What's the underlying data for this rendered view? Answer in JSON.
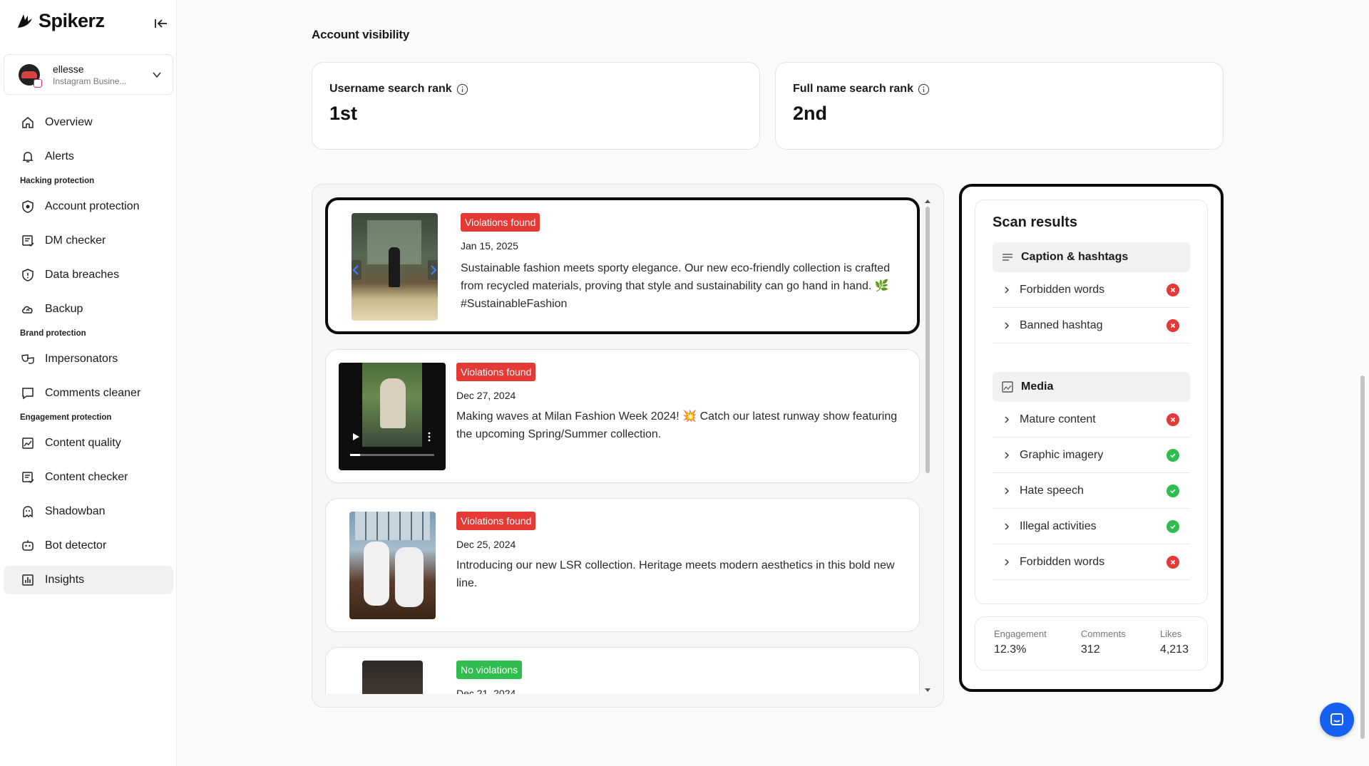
{
  "app": {
    "name": "Spikerz"
  },
  "account": {
    "name": "ellesse",
    "type": "Instagram Busine..."
  },
  "nav": {
    "overview": "Overview",
    "alerts": "Alerts",
    "section_hacking": "Hacking protection",
    "account_protection": "Account protection",
    "dm_checker": "DM checker",
    "data_breaches": "Data breaches",
    "backup": "Backup",
    "section_brand": "Brand protection",
    "impersonators": "Impersonators",
    "comments_cleaner": "Comments cleaner",
    "section_engagement": "Engagement protection",
    "content_quality": "Content quality",
    "content_checker": "Content checker",
    "shadowban": "Shadowban",
    "bot_detector": "Bot detector",
    "insights": "Insights"
  },
  "visibility": {
    "title": "Account visibility",
    "username_label": "Username search rank",
    "username_value": "1st",
    "fullname_label": "Full name search rank",
    "fullname_value": "2nd"
  },
  "posts": [
    {
      "badge": "Violations found",
      "status": "violation",
      "date": "Jan 15, 2025",
      "text": "Sustainable fashion meets sporty elegance. Our new eco-friendly collection is crafted from recycled materials, proving that style and sustainability can go hand in hand. 🌿 #SustainableFashion"
    },
    {
      "badge": "Violations found",
      "status": "violation",
      "date": "Dec 27, 2024",
      "text": "Making waves at Milan Fashion Week 2024! 💥 Catch our latest runway show featuring the upcoming Spring/Summer collection."
    },
    {
      "badge": "Violations found",
      "status": "violation",
      "date": "Dec 25, 2024",
      "text": "Introducing our new LSR collection. Heritage meets modern aesthetics in this bold new line."
    },
    {
      "badge": "No violations",
      "status": "clean",
      "date": "Dec 21, 2024",
      "text": ""
    }
  ],
  "scan": {
    "title": "Scan results",
    "caption_group": "Caption & hashtags",
    "caption_items": [
      {
        "label": "Forbidden words",
        "status": "fail"
      },
      {
        "label": "Banned hashtag",
        "status": "fail"
      }
    ],
    "media_group": "Media",
    "media_items": [
      {
        "label": "Mature content",
        "status": "fail"
      },
      {
        "label": "Graphic imagery",
        "status": "pass"
      },
      {
        "label": "Hate speech",
        "status": "pass"
      },
      {
        "label": "Illegal activities",
        "status": "pass"
      },
      {
        "label": "Forbidden words",
        "status": "fail"
      }
    ]
  },
  "stats": {
    "engagement_label": "Engagement",
    "engagement_value": "12.3%",
    "comments_label": "Comments",
    "comments_value": "312",
    "likes_label": "Likes",
    "likes_value": "4,213"
  },
  "colors": {
    "violation": "#e53935",
    "clean": "#2ebd4e",
    "chat": "#1560f0"
  }
}
